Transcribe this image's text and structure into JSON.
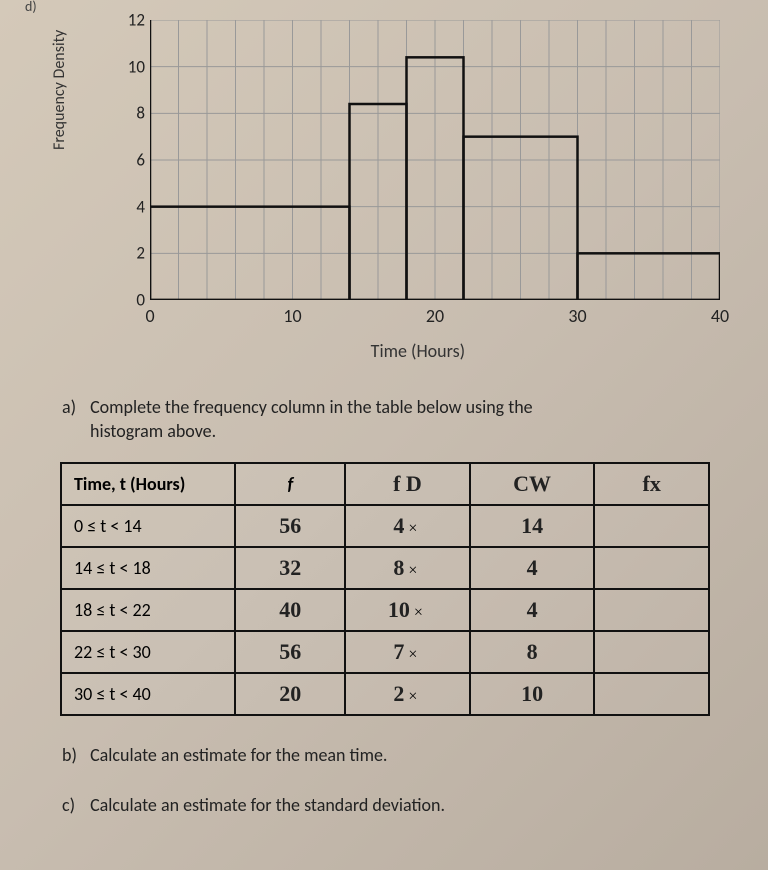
{
  "chart_data": {
    "type": "bar",
    "title": "",
    "xlabel": "Time (Hours)",
    "ylabel": "Frequency Density",
    "xlim": [
      0,
      40
    ],
    "ylim": [
      0,
      12
    ],
    "xticks": [
      0,
      10,
      20,
      30,
      40
    ],
    "yticks": [
      0,
      2,
      4,
      6,
      8,
      10,
      12
    ],
    "bins": [
      {
        "x0": 0,
        "x1": 14,
        "density": 4
      },
      {
        "x0": 14,
        "x1": 18,
        "density": 8.4
      },
      {
        "x0": 18,
        "x1": 22,
        "density": 10.4
      },
      {
        "x0": 22,
        "x1": 30,
        "density": 7
      },
      {
        "x0": 30,
        "x1": 40,
        "density": 2
      }
    ]
  },
  "part_label_top": "d)",
  "qa": {
    "label": "a)",
    "line1": "Complete the frequency column in the table below using the",
    "line2": "histogram above."
  },
  "table": {
    "h_time": "Time, t (Hours)",
    "h_f": "f",
    "h_fd": "f D",
    "h_cw": "CW",
    "h_fx": "fx",
    "rows": [
      {
        "time": "0 ≤ t < 14",
        "f": "56",
        "fd": "4",
        "op": "×",
        "cw": "14",
        "fx": ""
      },
      {
        "time": "14 ≤ t < 18",
        "f": "32",
        "fd": "8",
        "op": "×",
        "cw": "4",
        "fx": ""
      },
      {
        "time": "18 ≤ t < 22",
        "f": "40",
        "fd": "10",
        "op": "×",
        "cw": "4",
        "fx": ""
      },
      {
        "time": "22 ≤ t < 30",
        "f": "56",
        "fd": "7",
        "op": "×",
        "cw": "8",
        "fx": ""
      },
      {
        "time": "30 ≤ t < 40",
        "f": "20",
        "fd": "2",
        "op": "×",
        "cw": "10",
        "fx": ""
      }
    ]
  },
  "qb": {
    "label": "b)",
    "text": "Calculate an estimate for the mean time."
  },
  "qc": {
    "label": "c)",
    "text": "Calculate an estimate for the standard deviation."
  }
}
